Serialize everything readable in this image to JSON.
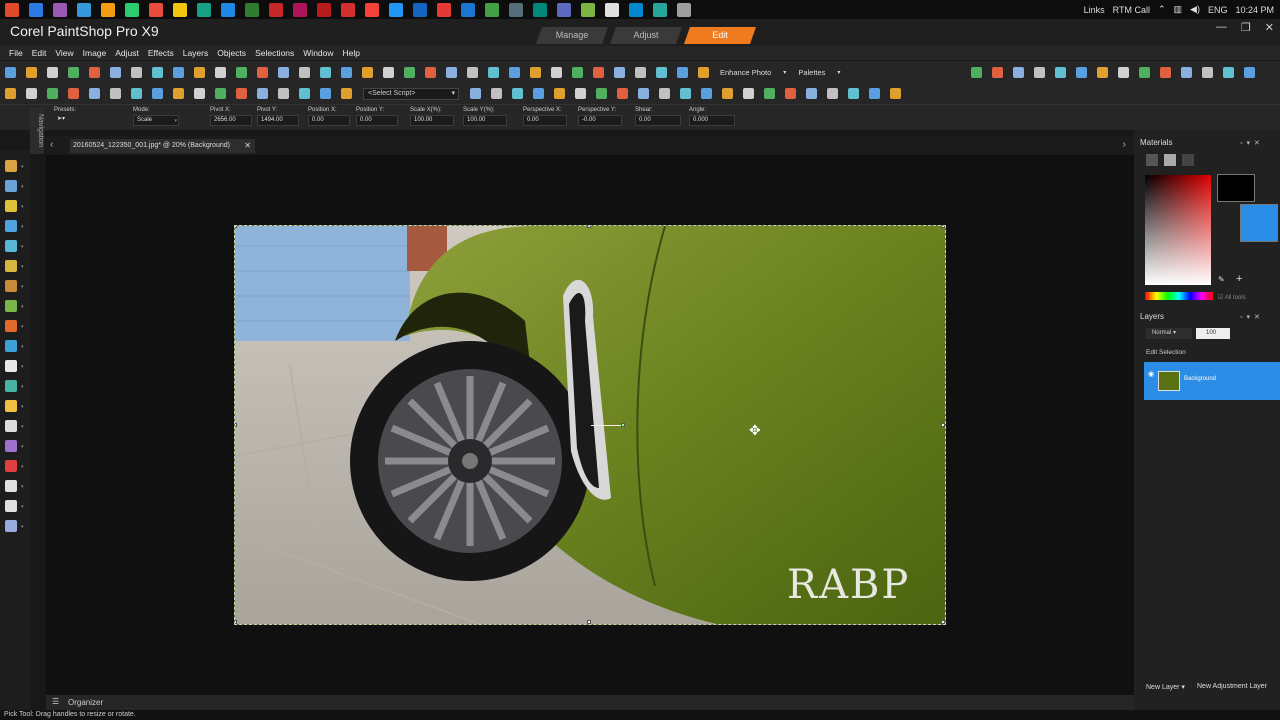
{
  "taskbar": {
    "icon_colors": [
      "#e04a2a",
      "#2c7be5",
      "#9b59b6",
      "#3498db",
      "#f39c12",
      "#2ecc71",
      "#e74c3c",
      "#f1c40f",
      "#16a085",
      "#1e88e5",
      "#2e7d32",
      "#c62828",
      "#ad1457",
      "#b71c1c",
      "#d32f2f",
      "#f44336",
      "#2196f3",
      "#1565c0",
      "#e53935",
      "#1976d2",
      "#43a047",
      "#546e7a",
      "#00897b",
      "#5c6bc0",
      "#7cb342",
      "#e0e0e0",
      "#0288d1",
      "#26a69a",
      "#9e9e9e"
    ],
    "tray": {
      "links": "Links",
      "rtm": "RTM Call",
      "lang": "ENG",
      "time": "10:24 PM"
    }
  },
  "app": {
    "title": "Corel PaintShop Pro X9",
    "tabs": [
      "Manage",
      "Adjust",
      "Edit"
    ],
    "active_tab": "Edit",
    "window_buttons": [
      "—",
      "❐",
      "✕"
    ]
  },
  "menu": [
    "File",
    "Edit",
    "View",
    "Image",
    "Adjust",
    "Effects",
    "Layers",
    "Objects",
    "Selections",
    "Window",
    "Help"
  ],
  "toolbar1": {
    "enhance_photo": "Enhance Photo",
    "palettes": "Palettes"
  },
  "toolbar2": {
    "script_placeholder": "<Select Script>"
  },
  "options": {
    "presets_label": "Presets:",
    "mode_label": "Mode:",
    "mode_value": "Scale",
    "pivot_x_label": "Pivot X:",
    "pivot_x": "2656.00",
    "pivot_y_label": "Pivot Y:",
    "pivot_y": "1494.00",
    "pos_x_label": "Position X:",
    "pos_x": "0.00",
    "pos_y_label": "Position Y:",
    "pos_y": "0.00",
    "scale_x_label": "Scale X(%):",
    "scale_x": "100.00",
    "scale_y_label": "Scale Y(%):",
    "scale_y": "100.00",
    "persp_x_label": "Perspective X:",
    "persp_x": "0.00",
    "persp_y_label": "Perspective Y:",
    "persp_y": "-0.00",
    "shear_label": "Shear:",
    "shear": "0.00",
    "angle_label": "Angle:",
    "angle": "0.000"
  },
  "navigation_label": "Navigation",
  "document": {
    "tab": "20160524_122350_001.jpg* @  20% (Background)",
    "watermark": "RABP"
  },
  "tool_colors": [
    "#d9a441",
    "#6aa3d8",
    "#e0c23a",
    "#4fa3e0",
    "#59b6d6",
    "#d4b640",
    "#c98b3a",
    "#7ab648",
    "#e06a2a",
    "#3ca3d9",
    "#e8e8e8",
    "#46b3a3",
    "#f0c040",
    "#ddd",
    "#a070d0",
    "#e04040",
    "#e0e0e0",
    "#e0e0e0",
    "#9ad"
  ],
  "organizer_label": "Organizer",
  "status": "Pick Tool: Drag handles to resize or rotate.",
  "materials": {
    "title": "Materials",
    "all_tools": "All tools",
    "fg_color": "#000000",
    "bg_color": "#2b8de6"
  },
  "layers": {
    "title": "Layers",
    "blend": "Normal",
    "opacity": "100",
    "edit_selection": "Edit Selection",
    "layer_name": "Background",
    "new_layer": "New Layer",
    "new_adjustment": "New Adjustment Layer"
  }
}
